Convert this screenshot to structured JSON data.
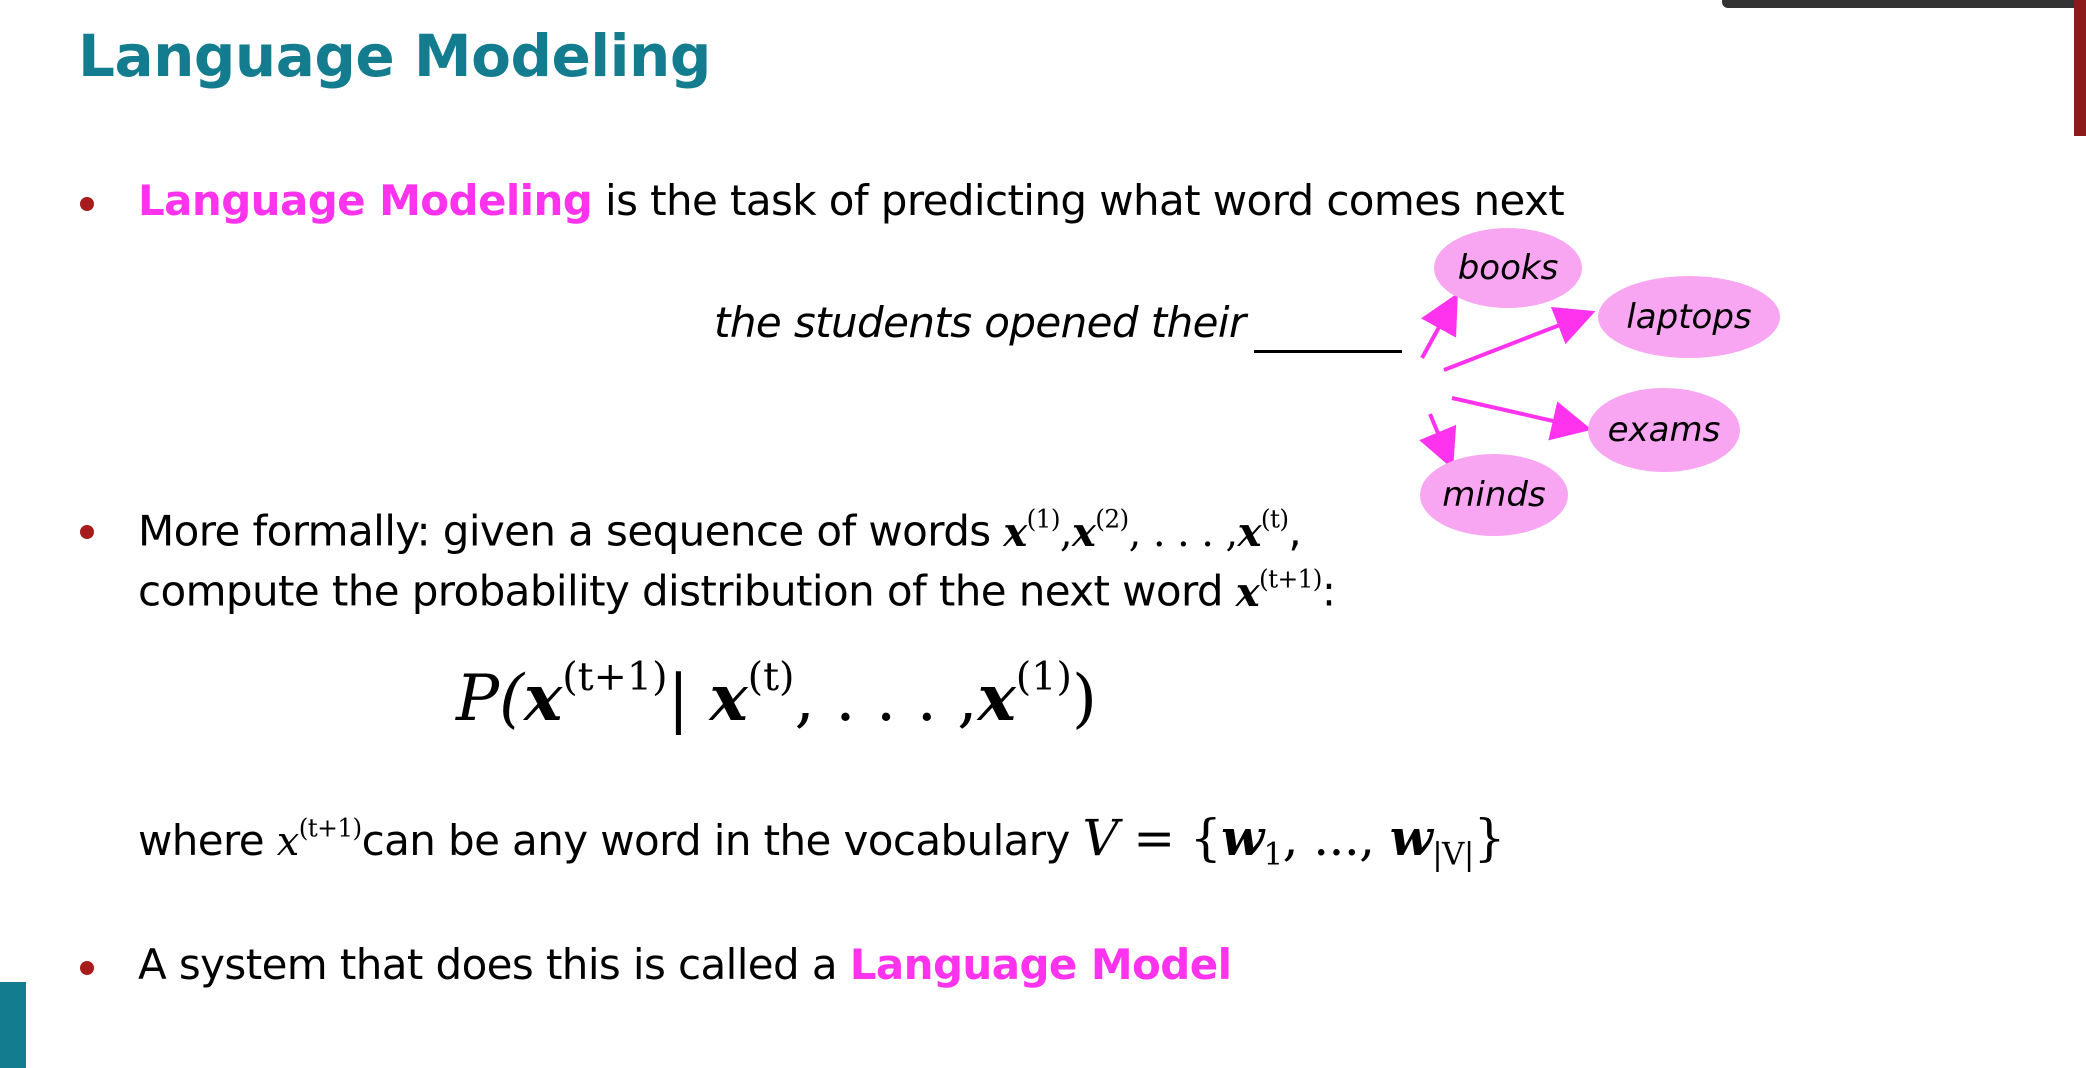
{
  "slide": {
    "title": "Language Modeling",
    "bullet1": {
      "term": "Language Modeling",
      "rest": " is the task of predicting what word comes next"
    },
    "example": {
      "sentence": "the students opened their",
      "blank": "______",
      "candidates": [
        "books",
        "laptops",
        "exams",
        "minds"
      ]
    },
    "bullet2": {
      "line1": "More formally: given a sequence of words",
      "line1_math": {
        "var": "x",
        "sup1": "(1)",
        "sup2": "(2)",
        "ellipsis": ", . . . ,",
        "supt": "(t)"
      },
      "line1_end": ",",
      "line2": "compute the probability distribution of the next word",
      "line2_sup": "(t+1)",
      "line2_end": ":"
    },
    "formula": {
      "P": "P(",
      "sup_next": "(t+1)",
      "bar": "|",
      "sup_t": "(t)",
      "ellipsis": ", . . . ,",
      "sup_1": "(1)",
      "close": ")"
    },
    "where_line": {
      "prefix": "where",
      "sup": "(t+1)",
      "middle": "can be any word in the vocabulary",
      "V": "V",
      "eq": " = {",
      "w": "w",
      "sub1": "1",
      "dots": ", ..., ",
      "subV": "|V|",
      "close": "}"
    },
    "bullet3": {
      "prefix": "A system that does this is called a ",
      "term": "Language Model"
    }
  },
  "colors": {
    "title": "#137c8e",
    "highlight": "#ff33ee",
    "bubble": "#f8a6f2",
    "bullet": "#a61c1c",
    "arrow": "#ff33ee"
  }
}
